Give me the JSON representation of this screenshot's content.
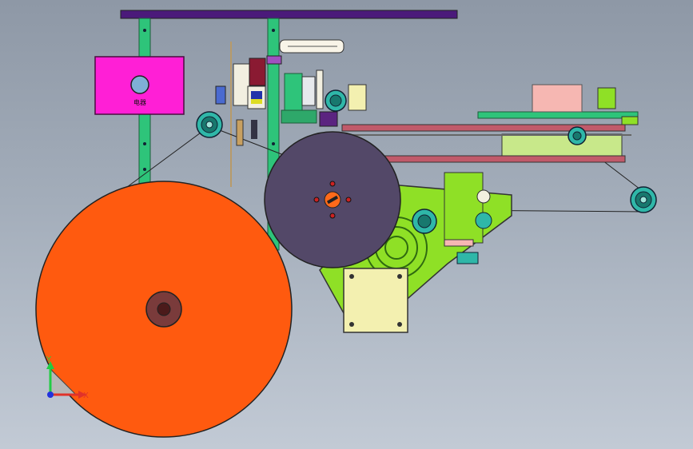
{
  "viewport": {
    "background_colors": [
      "#8e98a6",
      "#c2cad5"
    ]
  },
  "control_box": {
    "label": "电器",
    "color": "#ff1fd6"
  },
  "colors": {
    "top_beam": "#4b1a7a",
    "frame_post": "#2ec47a",
    "main_reel": "#ff5a0f",
    "reel_hub": "#7a3b3b",
    "drive_disc": "#534868",
    "mount_plate": "#8fe026",
    "motor_body": "#f3f0b0",
    "belt_rail": "#c15a6a",
    "idler_roller": "#2fb7a8",
    "guide_block": "#f6b7b2",
    "screw_handle": "#ff6a1a"
  },
  "triad": {
    "x_label": "X",
    "y_label": "Y",
    "x_color": "#e0322a",
    "y_color": "#22cc44",
    "z_color": "#2233dd"
  }
}
